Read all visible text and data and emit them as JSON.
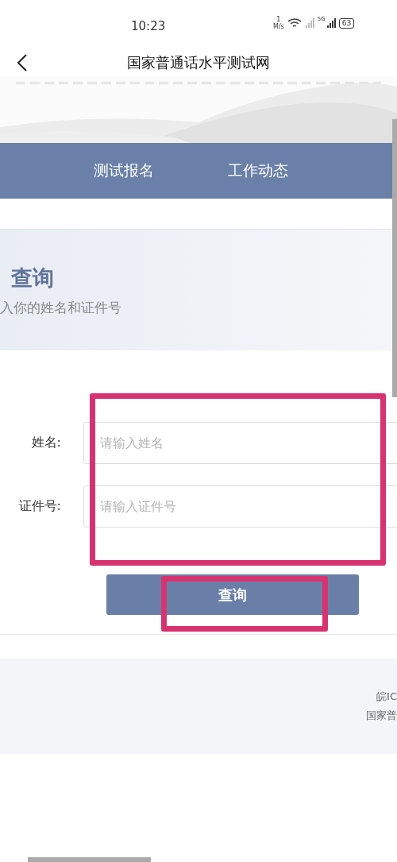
{
  "status_bar": {
    "time": "10:23",
    "speed_value": "1",
    "speed_unit": "M/s",
    "network": "5G",
    "battery": "63"
  },
  "header": {
    "title": "国家普通话水平测试网"
  },
  "nav": [
    {
      "label": "测试报名"
    },
    {
      "label": "工作动态"
    }
  ],
  "hero": {
    "title": "查询",
    "subtitle": "入你的姓名和证件号"
  },
  "form": {
    "fields": [
      {
        "label": "姓名:",
        "placeholder": "请输入姓名"
      },
      {
        "label": "证件号:",
        "placeholder": "请输入证件号"
      }
    ],
    "button": "查询"
  },
  "footer": {
    "lines": [
      "皖IC",
      "国家普"
    ]
  },
  "highlights": {
    "fields": true,
    "button": true
  }
}
